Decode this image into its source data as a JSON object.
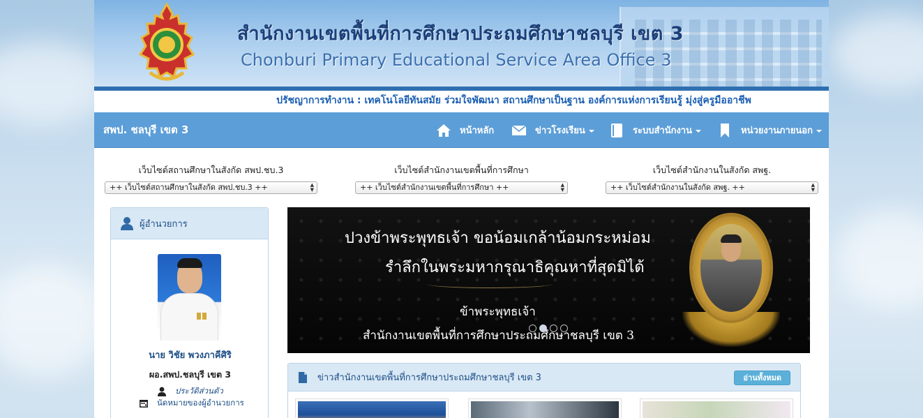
{
  "header": {
    "title_th": "สำนักงานเขตพื้นที่การศึกษาประถมศึกษาชลบุรี เขต 3",
    "title_en": "Chonburi Primary Educational Service Area Office 3",
    "philosophy": "ปรัชญาการทำงาน : เทคโนโลยีทันสมัย ร่วมใจพัฒนา สถานศึกษาเป็นฐาน องค์การแห่งการเรียนรู้ มุ่งสู่ครูมืออาชีพ"
  },
  "navbar": {
    "brand": "สพป. ชลบุรี เขต 3",
    "items": [
      {
        "label": "หน้าหลัก",
        "icon": "home-icon",
        "dropdown": false
      },
      {
        "label": "ข่าวโรงเรียน",
        "icon": "envelope-icon",
        "dropdown": true
      },
      {
        "label": "ระบบสำนักงาน",
        "icon": "book-icon",
        "dropdown": true
      },
      {
        "label": "หน่วยงานภายนอก",
        "icon": "bookmark-icon",
        "dropdown": true
      }
    ]
  },
  "selectors": [
    {
      "label": "เว็บไซต์สถานศึกษาในสังกัด สพป.ชบ.3",
      "value": "++ เว็บไซต์สถานศึกษาในสังกัด สพป.ชบ.3 ++"
    },
    {
      "label": "เว็บไซต์สำนักงานเขตพื้นที่การศึกษา",
      "value": "++ เว็บไซต์สำนักงานเขตพื้นที่การศึกษา ++"
    },
    {
      "label": "เว็บไซต์สำนักงานในสังกัด สพฐ.",
      "value": "++ เว็บไซต์สำนักงานในสังกัด สพฐ. ++"
    }
  ],
  "director_panel": {
    "heading": "ผู้อำนวยการ",
    "name": "นาย วิชัย พวงภาคีศิริ",
    "position": "ผอ.สพป.ชลบุรี เขต 3",
    "links": [
      {
        "label": "ประวัติส่วนตัว",
        "icon": "user-icon"
      },
      {
        "label": "นัดหมายของผู้อำนวยการ",
        "icon": "calendar-icon"
      }
    ]
  },
  "slider": {
    "line1": "ปวงข้าพระพุทธเจ้า ขอน้อมเกล้าน้อมกระหม่อม",
    "line2": "รำลึกในพระมหากรุณาธิคุณหาที่สุดมิได้",
    "line3": "ข้าพระพุทธเจ้า",
    "line4": "สำนักงานเขตพื้นที่การศึกษาประถมศึกษาชลบุรี เขต 3",
    "slide_count": 4,
    "active_slide": 2
  },
  "news": {
    "heading": "ข่าวสำนักงานเขตพื้นที่การศึกษาประถมศึกษาชลบุรี เขต 3",
    "read_all": "อ่านทั้งหมด"
  },
  "colors": {
    "navbar": "#5c9ed8",
    "panel_head": "#d9e8f5",
    "link": "#1d4f86",
    "readall_button": "#5bb0d9"
  }
}
